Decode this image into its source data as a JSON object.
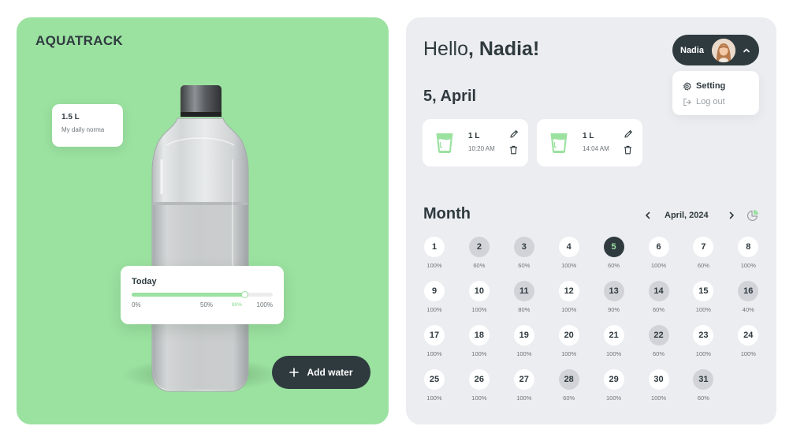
{
  "app": {
    "brand": "AQUATRACK"
  },
  "left": {
    "daily_norma": {
      "value": "1.5 L",
      "label": "My daily norma"
    },
    "today": {
      "title": "Today",
      "progress": 0.8,
      "ticks": {
        "start": "0%",
        "mid": "50%",
        "current": "80%",
        "end": "100%"
      }
    },
    "add_water_label": "Add water"
  },
  "header": {
    "hello": "Hello",
    "name": ", Nadia!",
    "user": {
      "name": "Nadia"
    },
    "menu": {
      "setting": "Setting",
      "logout": "Log out"
    }
  },
  "day": {
    "title": "5, April",
    "entries": [
      {
        "amount": "1 L",
        "time": "10:20 AM"
      },
      {
        "amount": "1 L",
        "time": "14:04 AM"
      }
    ]
  },
  "calendar": {
    "title": "Month",
    "month_label": "April, 2024",
    "selected_day": 5,
    "days": [
      {
        "day": "1",
        "pct": "100%"
      },
      {
        "day": "2",
        "pct": "60%"
      },
      {
        "day": "3",
        "pct": "60%"
      },
      {
        "day": "4",
        "pct": "100%"
      },
      {
        "day": "5",
        "pct": "60%"
      },
      {
        "day": "6",
        "pct": "100%"
      },
      {
        "day": "7",
        "pct": "60%"
      },
      {
        "day": "8",
        "pct": "100%"
      },
      {
        "day": "9",
        "pct": "100%"
      },
      {
        "day": "10",
        "pct": "100%"
      },
      {
        "day": "11",
        "pct": "80%"
      },
      {
        "day": "12",
        "pct": "100%"
      },
      {
        "day": "13",
        "pct": "90%"
      },
      {
        "day": "14",
        "pct": "60%"
      },
      {
        "day": "15",
        "pct": "100%"
      },
      {
        "day": "16",
        "pct": "40%"
      },
      {
        "day": "17",
        "pct": "100%"
      },
      {
        "day": "18",
        "pct": "100%"
      },
      {
        "day": "19",
        "pct": "100%"
      },
      {
        "day": "20",
        "pct": "100%"
      },
      {
        "day": "21",
        "pct": "100%"
      },
      {
        "day": "22",
        "pct": "60%"
      },
      {
        "day": "23",
        "pct": "100%"
      },
      {
        "day": "24",
        "pct": "100%"
      },
      {
        "day": "25",
        "pct": "100%"
      },
      {
        "day": "26",
        "pct": "100%"
      },
      {
        "day": "27",
        "pct": "100%"
      },
      {
        "day": "28",
        "pct": "60%"
      },
      {
        "day": "29",
        "pct": "100%"
      },
      {
        "day": "30",
        "pct": "100%"
      },
      {
        "day": "31",
        "pct": "60%"
      }
    ],
    "partial_days": [
      2,
      3,
      11,
      13,
      14,
      16,
      22,
      28,
      31
    ]
  },
  "colors": {
    "accent_green": "#9be1a0",
    "dark": "#2f3a3f",
    "panel_gray": "#ecedf1",
    "partial_day": "#d1d3d8"
  },
  "icons": {
    "add": "plus-icon",
    "menu_toggle": "chevron-up-icon",
    "setting": "gear-icon",
    "logout": "logout-icon",
    "entry": "glass-icon",
    "edit": "pencil-icon",
    "delete": "trash-icon",
    "prev": "chevron-left-icon",
    "next": "chevron-right-icon",
    "stats": "pie-chart-icon"
  }
}
